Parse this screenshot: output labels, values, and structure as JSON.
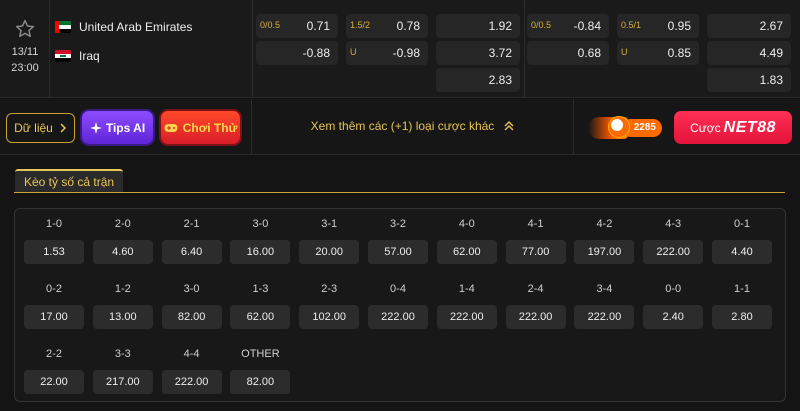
{
  "match": {
    "date": "13/11",
    "time": "23:00",
    "home": "United Arab Emirates",
    "away": "Iraq",
    "favorite_icon": "star-icon"
  },
  "odds": {
    "ft_handicap": [
      {
        "label": "0/0.5",
        "value": "0.71"
      },
      {
        "label": "",
        "value": "-0.88"
      }
    ],
    "ft_overunder": [
      {
        "label": "1.5/2",
        "value": "0.78"
      },
      {
        "label": "U",
        "value": "-0.98"
      }
    ],
    "ft_1x2": [
      "1.92",
      "3.72",
      "2.83"
    ],
    "h1_handicap": [
      {
        "label": "0/0.5",
        "value": "-0.84"
      },
      {
        "label": "",
        "value": "0.68"
      }
    ],
    "h1_overunder": [
      {
        "label": "0.5/1",
        "value": "0.95"
      },
      {
        "label": "U",
        "value": "0.85"
      }
    ],
    "h1_1x2": [
      "2.67",
      "4.49",
      "1.83"
    ]
  },
  "actions": {
    "data_label": "Dữ liệu",
    "tips_label": "Tips AI",
    "game_label": "Chơi Thử",
    "more_label": "Xem thêm các (+1) loại cược khác",
    "promo_value": "2285",
    "bet_label": "Cược",
    "brand": "NET88"
  },
  "correct_score": {
    "tab_label": "Kèo tỷ số cả trận",
    "rows": [
      [
        {
          "s": "1-0",
          "o": "1.53"
        },
        {
          "s": "2-0",
          "o": "4.60"
        },
        {
          "s": "2-1",
          "o": "6.40"
        },
        {
          "s": "3-0",
          "o": "16.00"
        },
        {
          "s": "3-1",
          "o": "20.00"
        },
        {
          "s": "3-2",
          "o": "57.00"
        },
        {
          "s": "4-0",
          "o": "62.00"
        },
        {
          "s": "4-1",
          "o": "77.00"
        },
        {
          "s": "4-2",
          "o": "197.00"
        },
        {
          "s": "4-3",
          "o": "222.00"
        },
        {
          "s": "0-1",
          "o": "4.40"
        }
      ],
      [
        {
          "s": "0-2",
          "o": "17.00"
        },
        {
          "s": "1-2",
          "o": "13.00"
        },
        {
          "s": "3-0",
          "o": "82.00"
        },
        {
          "s": "1-3",
          "o": "62.00"
        },
        {
          "s": "2-3",
          "o": "102.00"
        },
        {
          "s": "0-4",
          "o": "222.00"
        },
        {
          "s": "1-4",
          "o": "222.00"
        },
        {
          "s": "2-4",
          "o": "222.00"
        },
        {
          "s": "3-4",
          "o": "222.00"
        },
        {
          "s": "0-0",
          "o": "2.40"
        },
        {
          "s": "1-1",
          "o": "2.80"
        }
      ],
      [
        {
          "s": "2-2",
          "o": "22.00"
        },
        {
          "s": "3-3",
          "o": "217.00"
        },
        {
          "s": "4-4",
          "o": "222.00"
        },
        {
          "s": "OTHER",
          "o": "82.00"
        }
      ]
    ]
  },
  "colors": {
    "accent_gold": "#e8c658",
    "tips_purple": "#7a3cf0",
    "game_red": "#e8262a",
    "brand_red": "#f0204a"
  }
}
